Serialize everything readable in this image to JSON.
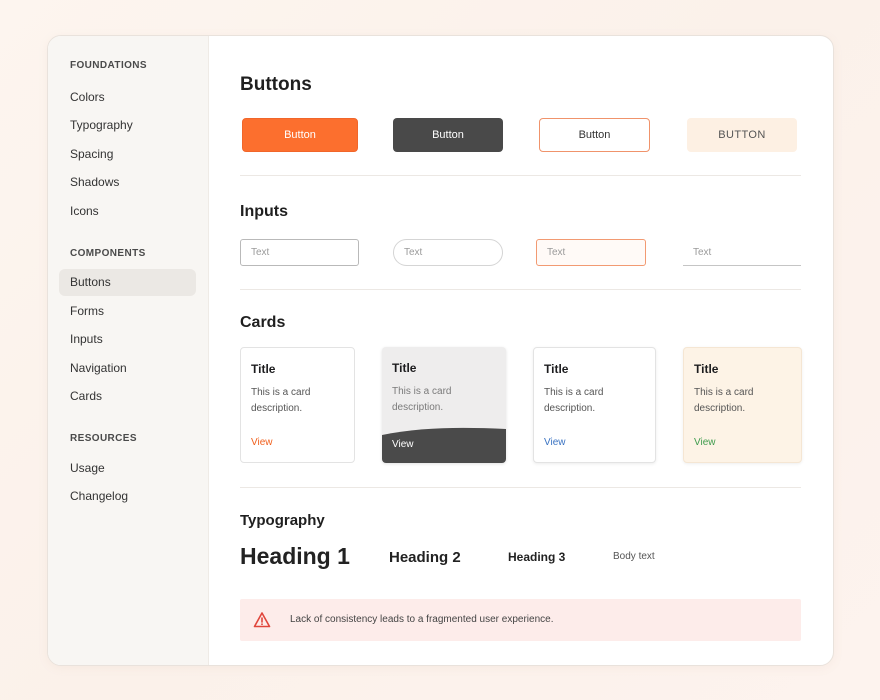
{
  "sidebar": {
    "sections": [
      {
        "title": "FOUNDATIONS",
        "items": [
          "Colors",
          "Typography",
          "Spacing",
          "Shadows",
          "Icons"
        ]
      },
      {
        "title": "COMPONENTS",
        "items": [
          "Buttons",
          "Forms",
          "Inputs",
          "Navigation",
          "Cards"
        ]
      },
      {
        "title": "RESOURCES",
        "items": [
          "Usage",
          "Changelog"
        ]
      }
    ],
    "active_item": "Buttons"
  },
  "main": {
    "buttons": {
      "title": "Buttons",
      "primary_label": "Button",
      "dark_label": "Button",
      "outline_label": "Button",
      "soft_label": "BUTTON"
    },
    "inputs": {
      "title": "Inputs",
      "placeholders": [
        "Text",
        "Text",
        "Text",
        "Text"
      ]
    },
    "cards": {
      "title": "Cards",
      "items": [
        {
          "title": "Title",
          "description": "This is a card description.",
          "link": "View"
        },
        {
          "title": "Title",
          "description": "This is a card description.",
          "link": "View"
        },
        {
          "title": "Title",
          "description": "This is a card description.",
          "link": "View"
        },
        {
          "title": "Title",
          "description": "This is a card description.",
          "link": "View"
        }
      ]
    },
    "typography": {
      "title": "Typography",
      "heading1": "Heading 1",
      "heading2": "Heading 2",
      "heading3": "Heading 3",
      "body": "Body text"
    },
    "alert": {
      "icon": "warning-icon",
      "text": "Lack of consistency leads to a fragmented user experience."
    }
  },
  "colors": {
    "accent": "#fc6f2e",
    "dark": "#494949",
    "soft": "#fdf0e3",
    "link_blue": "#3a73c2",
    "link_green": "#3f9c4e",
    "alert_bg": "#fdecea"
  }
}
